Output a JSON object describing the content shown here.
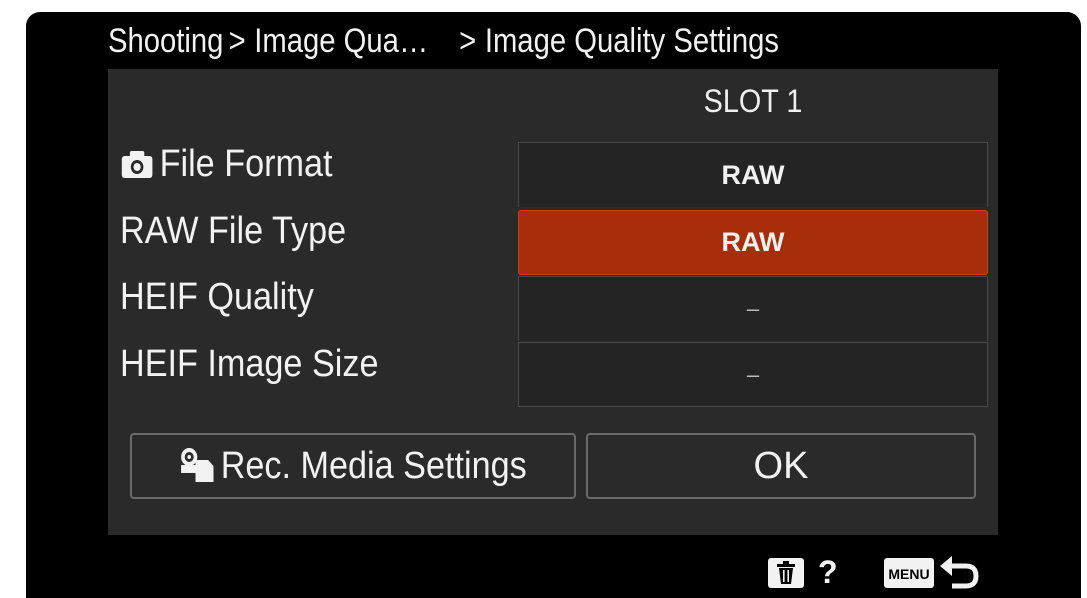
{
  "breadcrumb": {
    "parts": [
      "Shooting",
      "Image Qua…",
      "Image Quality Settings"
    ],
    "separator": ">"
  },
  "slot_header": "SLOT 1",
  "rows": [
    {
      "label": "File Format",
      "value": "RAW",
      "icon": "camera-icon"
    },
    {
      "label": "RAW File Type",
      "value": "RAW",
      "selected": true
    },
    {
      "label": "HEIF Quality",
      "value": "–"
    },
    {
      "label": "HEIF Image Size",
      "value": "–"
    }
  ],
  "buttons": {
    "media_label": "Rec. Media Settings",
    "media_icon": "rec-media-icon",
    "ok_label": "OK"
  },
  "footer": {
    "trash_icon": "trash-icon",
    "help_label": "?",
    "menu_label": "MENU",
    "return_icon": "return-icon"
  },
  "colors": {
    "background": "#000000",
    "panel": "#2a2a2a",
    "selection": "#a82e09",
    "text": "#f2f2f2"
  }
}
